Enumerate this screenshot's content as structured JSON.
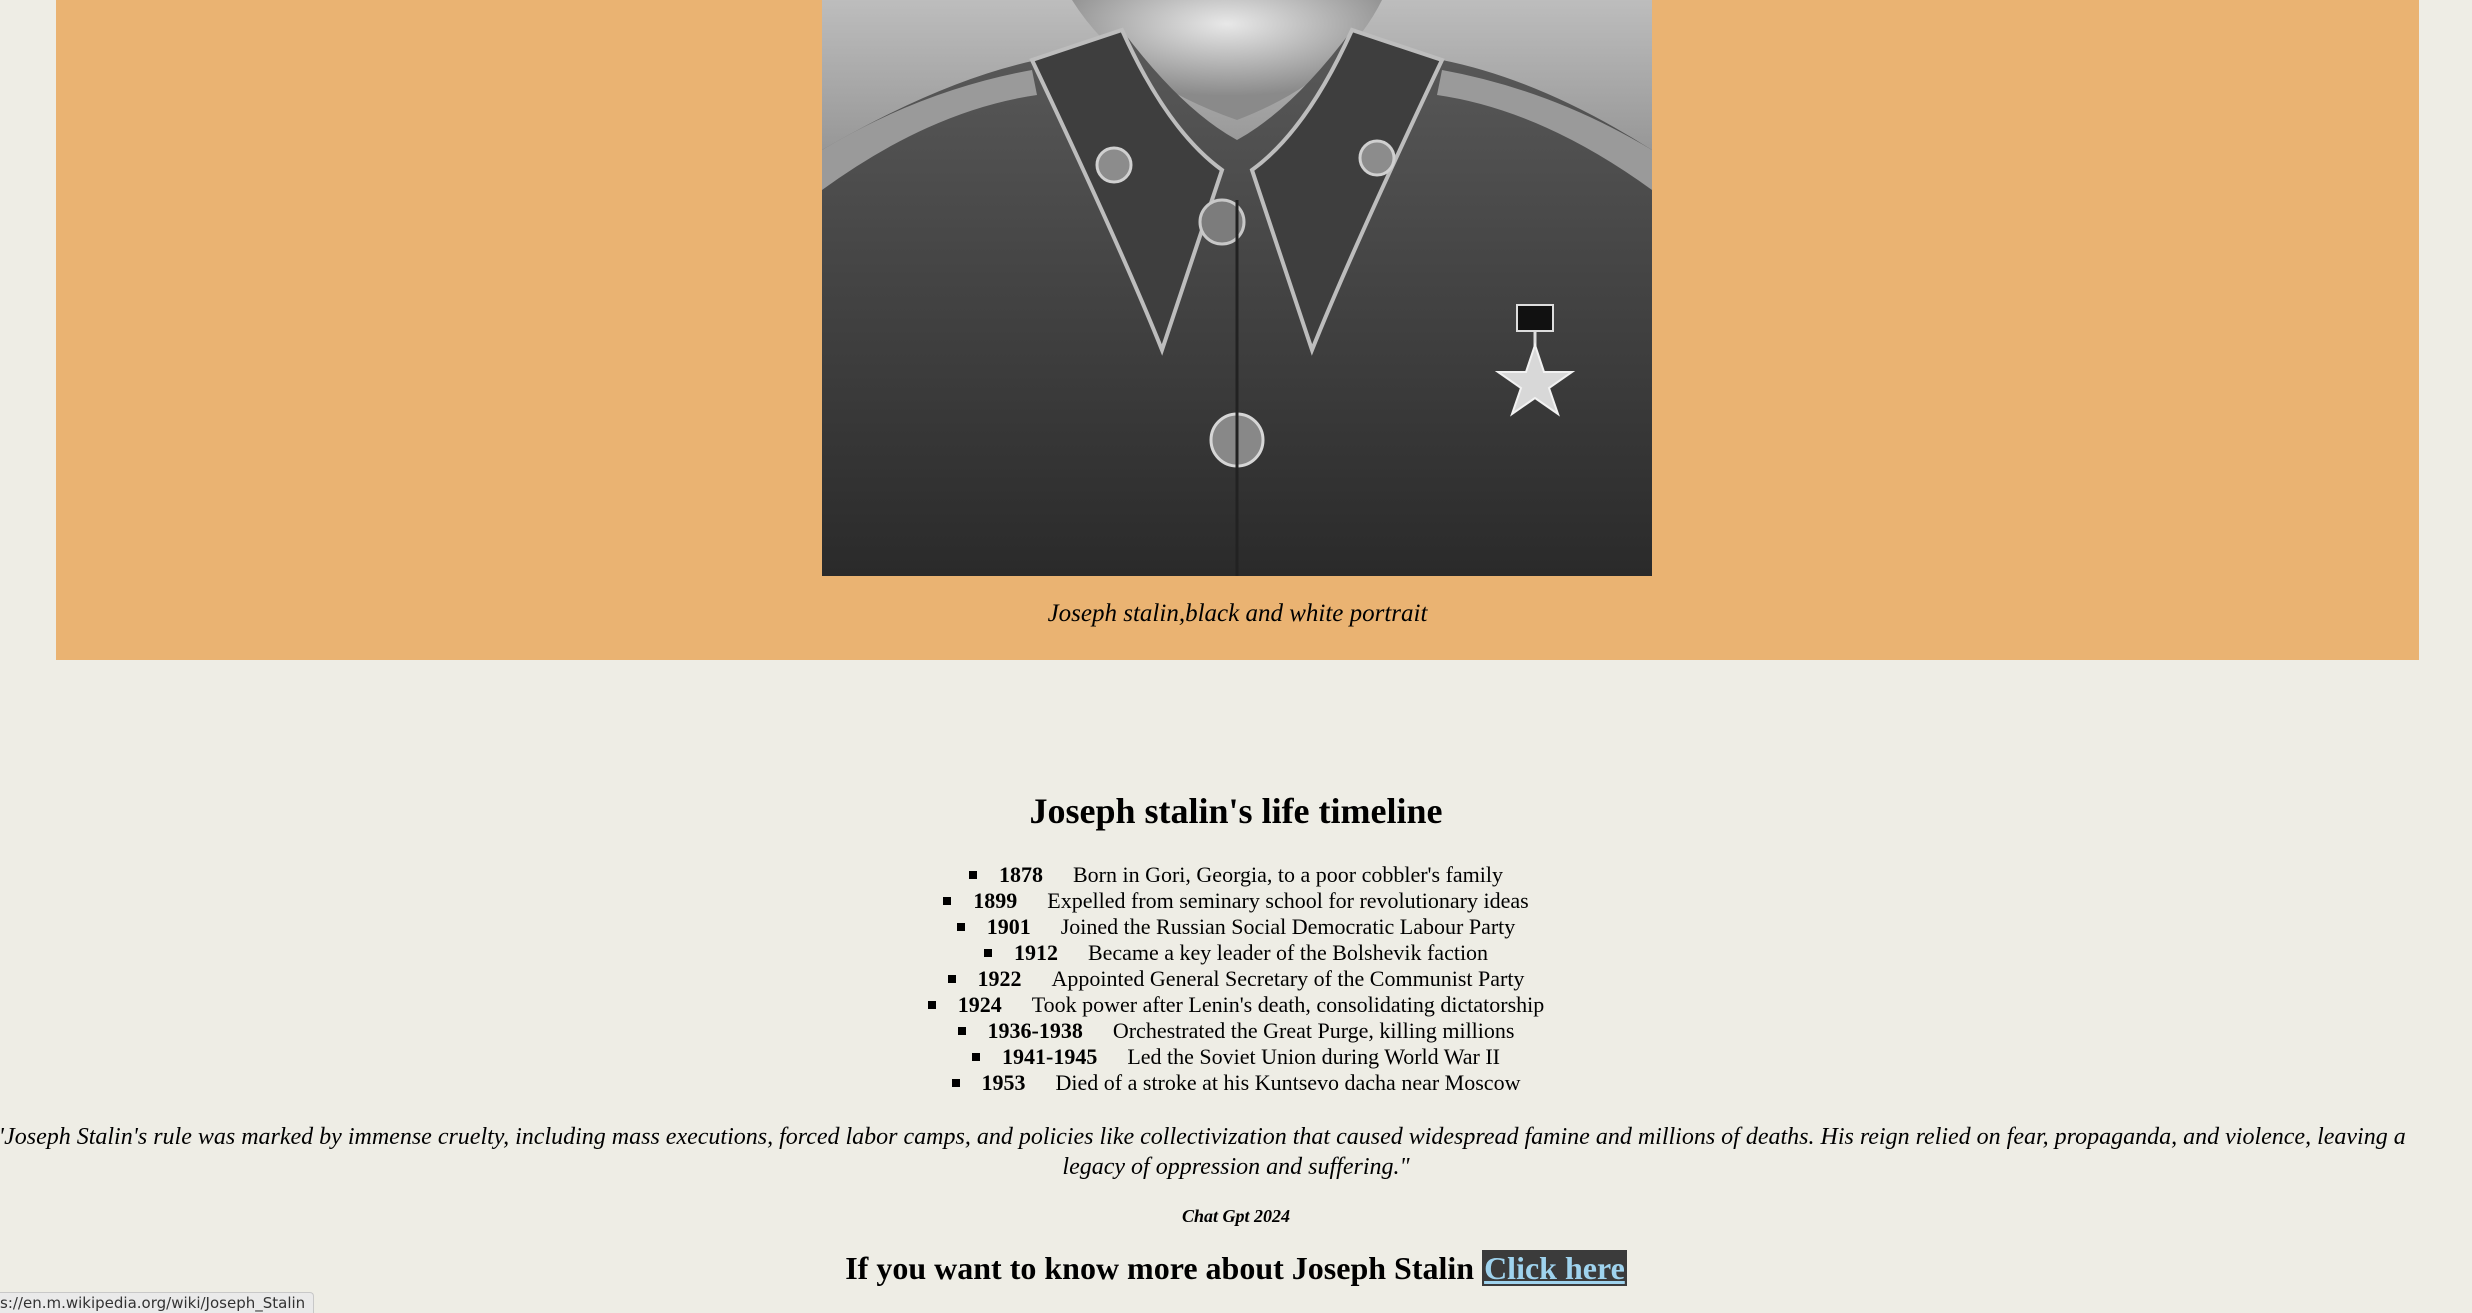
{
  "figure": {
    "caption": "Joseph stalin,black and white portrait",
    "image_subject": "black-and-white portrait of Joseph Stalin in military uniform with star medal"
  },
  "timeline": {
    "title": "Joseph stalin's life timeline",
    "items": [
      {
        "year": "1878",
        "event": "Born in Gori, Georgia, to a poor cobbler's family"
      },
      {
        "year": "1899",
        "event": "Expelled from seminary school for revolutionary ideas"
      },
      {
        "year": "1901",
        "event": "Joined the Russian Social Democratic Labour Party"
      },
      {
        "year": "1912",
        "event": "Became a key leader of the Bolshevik faction"
      },
      {
        "year": "1922",
        "event": "Appointed General Secretary of the Communist Party"
      },
      {
        "year": "1924",
        "event": "Took power after Lenin's death, consolidating dictatorship"
      },
      {
        "year": "1936-1938",
        "event": "Orchestrated the Great Purge, killing millions"
      },
      {
        "year": "1941-1945",
        "event": "Led the Soviet Union during World War II"
      },
      {
        "year": "1953",
        "event": "Died of a stroke at his Kuntsevo dacha near Moscow"
      }
    ]
  },
  "quote": {
    "line1": "\"Joseph Stalin's rule was marked by immense cruelty, including mass executions, forced labor camps, and policies like collectivization that caused widespread famine and millions of deaths. His reign relied on fear, propaganda, and violence, leaving a",
    "line2": "legacy of oppression and suffering.\"",
    "attribution": "Chat Gpt 2024"
  },
  "more_info": {
    "text": "If you want to know more about Joseph Stalin",
    "link_label": "Click here"
  },
  "status_bar": {
    "url": "s://en.m.wikipedia.org/wiki/Joseph_Stalin"
  }
}
